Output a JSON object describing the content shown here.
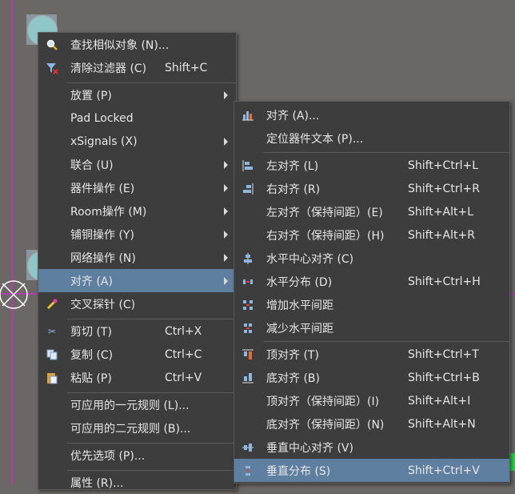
{
  "main_menu": {
    "items": [
      {
        "label": "查找相似对象 (N)...",
        "icon": "search-icon",
        "shortcut": ""
      },
      {
        "label": "清除过滤器 (C)",
        "icon": "clear-filter-icon",
        "shortcut": "Shift+C"
      },
      {
        "label": "放置 (P)",
        "icon": "",
        "shortcut": "",
        "submenu": true
      },
      {
        "label": "Pad Locked",
        "icon": "",
        "shortcut": ""
      },
      {
        "label": "xSignals (X)",
        "icon": "",
        "shortcut": "",
        "submenu": true
      },
      {
        "label": "联合 (U)",
        "icon": "",
        "shortcut": "",
        "submenu": true
      },
      {
        "label": "器件操作 (E)",
        "icon": "",
        "shortcut": "",
        "submenu": true
      },
      {
        "label": "Room操作 (M)",
        "icon": "",
        "shortcut": "",
        "submenu": true
      },
      {
        "label": "铺铜操作 (Y)",
        "icon": "",
        "shortcut": "",
        "submenu": true
      },
      {
        "label": "网络操作 (N)",
        "icon": "",
        "shortcut": "",
        "submenu": true
      },
      {
        "label": "对齐 (A)",
        "icon": "",
        "shortcut": "",
        "submenu": true,
        "highlighted": true
      },
      {
        "label": "交叉探针 (C)",
        "icon": "cross-probe-icon",
        "shortcut": ""
      },
      {
        "label": "剪切 (T)",
        "icon": "scissors-icon",
        "shortcut": "Ctrl+X"
      },
      {
        "label": "复制 (C)",
        "icon": "copy-icon",
        "shortcut": "Ctrl+C"
      },
      {
        "label": "粘贴 (P)",
        "icon": "paste-icon",
        "shortcut": "Ctrl+V"
      },
      {
        "label": "可应用的一元规则 (L)...",
        "icon": "",
        "shortcut": ""
      },
      {
        "label": "可应用的二元规则 (B)...",
        "icon": "",
        "shortcut": ""
      },
      {
        "label": "优先选项 (P)...",
        "icon": "",
        "shortcut": ""
      },
      {
        "label": "属性 (R)...",
        "icon": "",
        "shortcut": ""
      }
    ]
  },
  "sub_menu": {
    "items": [
      {
        "label": "对齐 (A)...",
        "icon": "align-icon",
        "shortcut": ""
      },
      {
        "label": "定位器件文本 (P)...",
        "icon": "",
        "shortcut": ""
      },
      {
        "label": "左对齐 (L)",
        "icon": "align-left-icon",
        "shortcut": "Shift+Ctrl+L"
      },
      {
        "label": "右对齐 (R)",
        "icon": "align-right-icon",
        "shortcut": "Shift+Ctrl+R"
      },
      {
        "label": "左对齐（保持间距）(E)",
        "icon": "",
        "shortcut": "Shift+Alt+L"
      },
      {
        "label": "右对齐（保持间距）(H)",
        "icon": "",
        "shortcut": "Shift+Alt+R"
      },
      {
        "label": "水平中心对齐 (C)",
        "icon": "align-hcenter-icon",
        "shortcut": ""
      },
      {
        "label": "水平分布 (D)",
        "icon": "distribute-h-icon",
        "shortcut": "Shift+Ctrl+H"
      },
      {
        "label": "增加水平间距",
        "icon": "increase-hspace-icon",
        "shortcut": ""
      },
      {
        "label": "减少水平间距",
        "icon": "decrease-hspace-icon",
        "shortcut": ""
      },
      {
        "label": "顶对齐 (T)",
        "icon": "align-top-icon",
        "shortcut": "Shift+Ctrl+T"
      },
      {
        "label": "底对齐 (B)",
        "icon": "align-bottom-icon",
        "shortcut": "Shift+Ctrl+B"
      },
      {
        "label": "顶对齐（保持间距）(I)",
        "icon": "",
        "shortcut": "Shift+Alt+I"
      },
      {
        "label": "底对齐（保持间距）(N)",
        "icon": "",
        "shortcut": "Shift+Alt+N"
      },
      {
        "label": "垂直中心对齐 (V)",
        "icon": "align-vcenter-icon",
        "shortcut": ""
      },
      {
        "label": "垂直分布 (S)",
        "icon": "distribute-v-icon",
        "shortcut": "Shift+Ctrl+V",
        "highlighted": true
      }
    ]
  },
  "colors": {
    "menu_bg": "#3d3d3d",
    "highlight": "#5e7fa0",
    "canvas": "#6b6765",
    "guide": "#b23bb0"
  }
}
